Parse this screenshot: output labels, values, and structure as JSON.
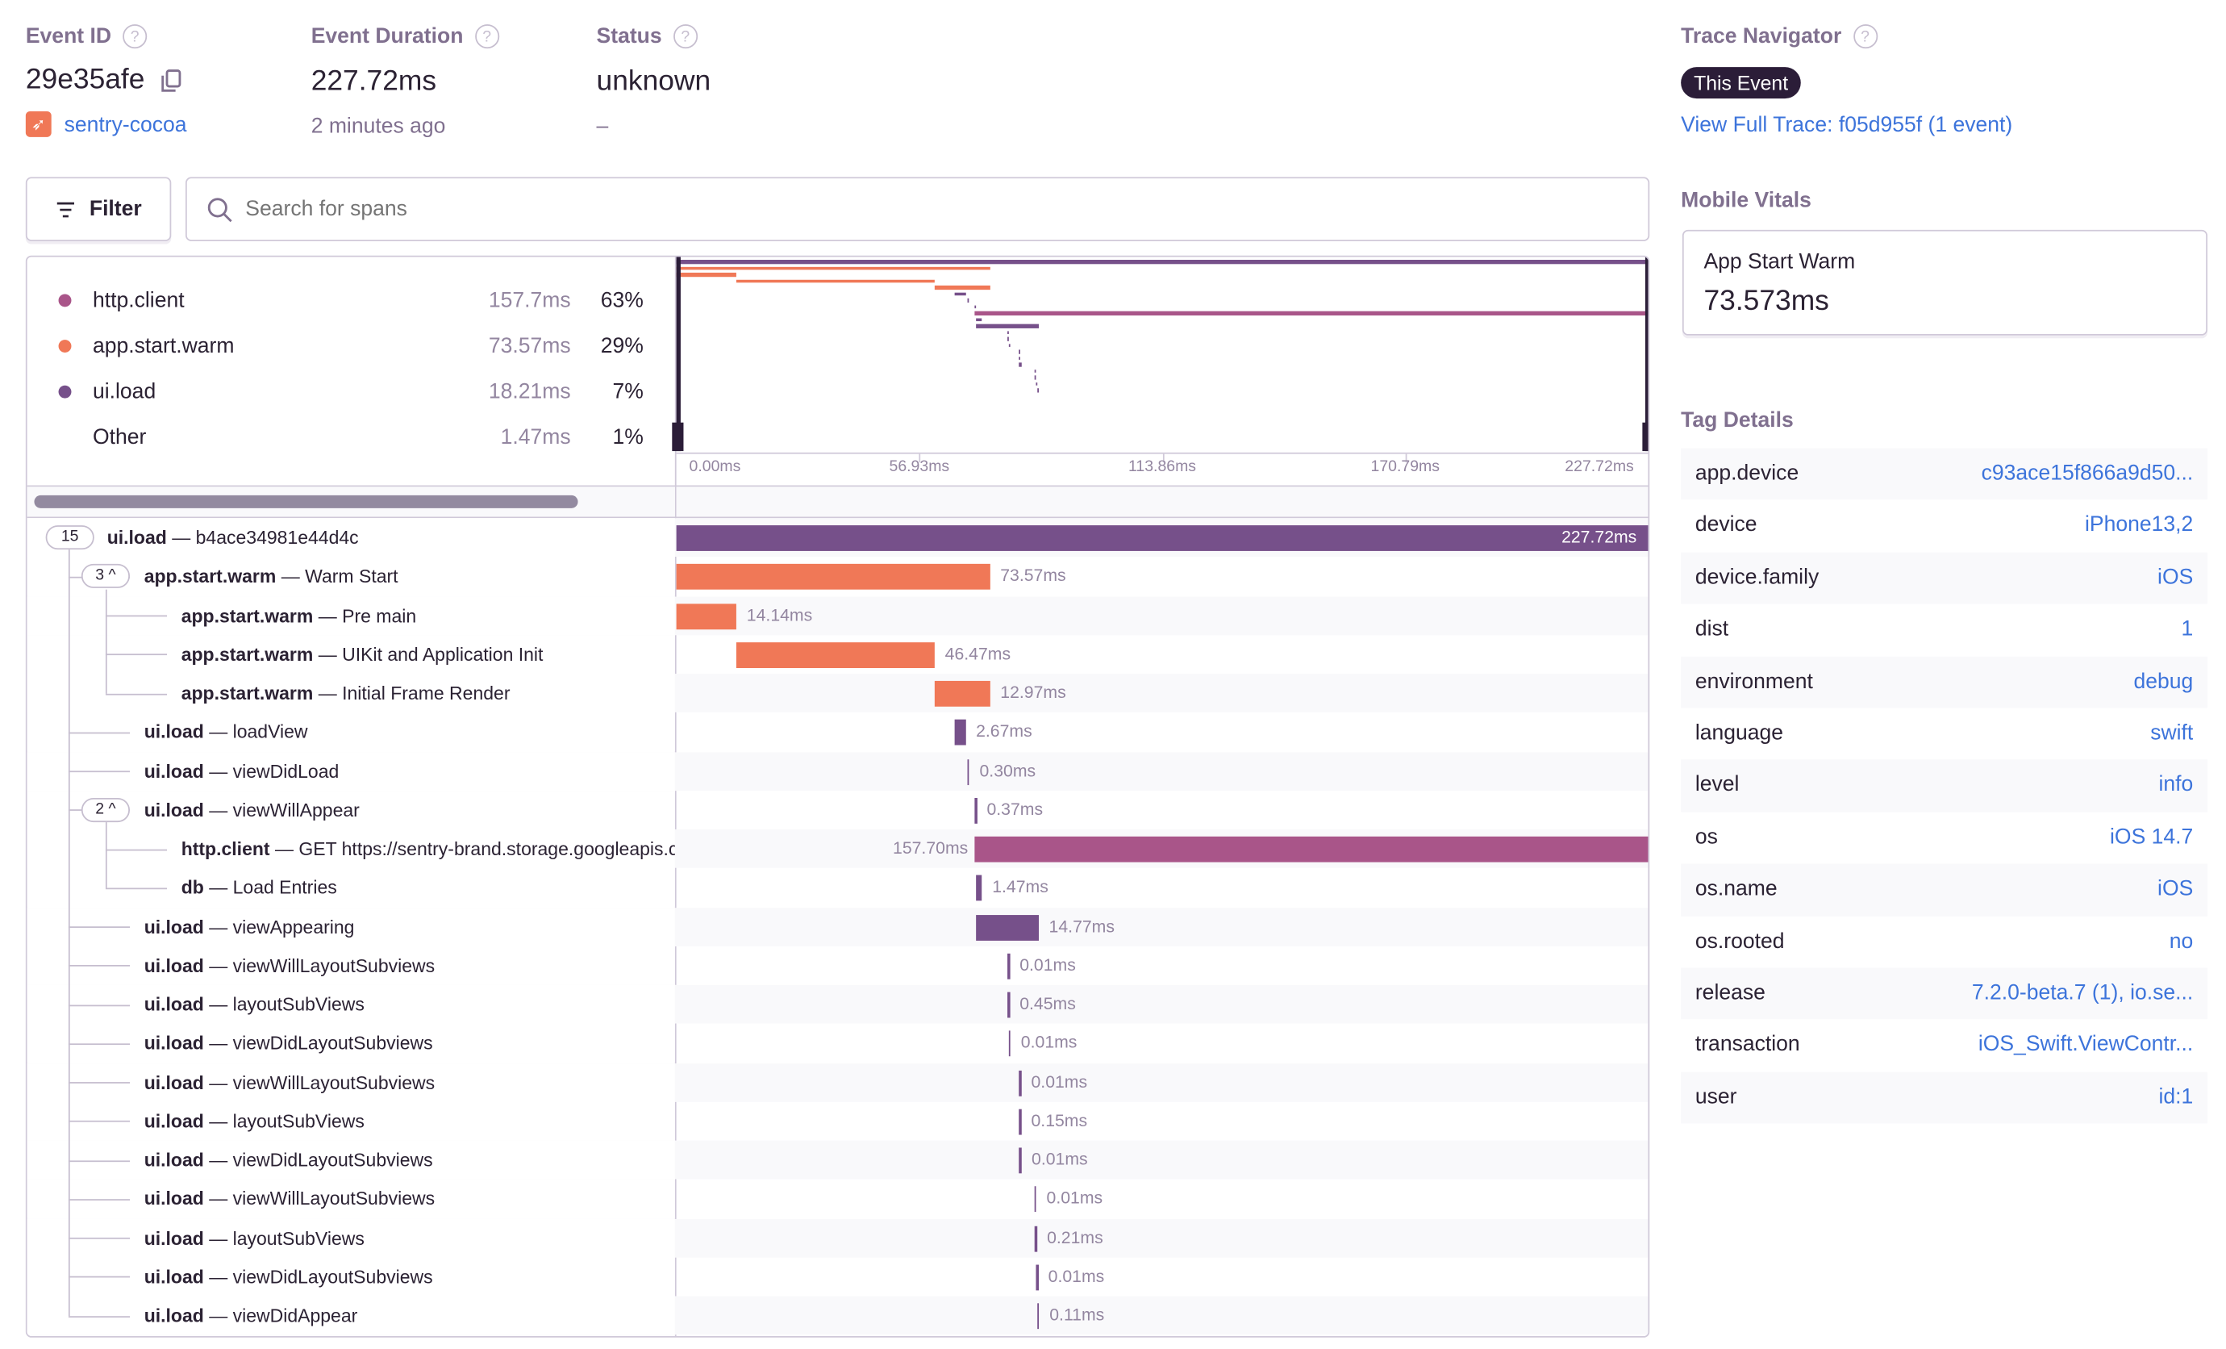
{
  "header": {
    "event_id": {
      "label": "Event ID",
      "value": "29e35afe",
      "project": "sentry-cocoa"
    },
    "duration": {
      "label": "Event Duration",
      "value": "227.72ms",
      "relative_time": "2 minutes ago"
    },
    "status": {
      "label": "Status",
      "value": "unknown",
      "sub": "–"
    }
  },
  "toolbar": {
    "filter_label": "Filter",
    "search_placeholder": "Search for spans"
  },
  "legend": [
    {
      "op": "http.client",
      "duration": "157.7ms",
      "percent": "63%",
      "color": "#a95589"
    },
    {
      "op": "app.start.warm",
      "duration": "73.57ms",
      "percent": "29%",
      "color": "#f07857"
    },
    {
      "op": "ui.load",
      "duration": "18.21ms",
      "percent": "7%",
      "color": "#76508a"
    },
    {
      "op": "Other",
      "duration": "1.47ms",
      "percent": "1%",
      "color": ""
    }
  ],
  "axis_ticks": [
    "0.00ms",
    "56.93ms",
    "113.86ms",
    "170.79ms",
    "227.72ms"
  ],
  "trace_total_ms": 227.72,
  "colors": {
    "ui.load": "#76508a",
    "app.start.warm": "#f07857",
    "http.client": "#a95589",
    "db": "#76508a"
  },
  "spans": [
    {
      "op": "ui.load",
      "desc": "b4ace34981e44d4c",
      "duration": "227.72ms",
      "start": 0,
      "ms": 227.72,
      "depth": 0,
      "badge": "15"
    },
    {
      "op": "app.start.warm",
      "desc": "Warm Start",
      "duration": "73.57ms",
      "start": 0,
      "ms": 73.57,
      "depth": 1,
      "badge": "3 ^"
    },
    {
      "op": "app.start.warm",
      "desc": "Pre main",
      "duration": "14.14ms",
      "start": 0,
      "ms": 14.14,
      "depth": 2
    },
    {
      "op": "app.start.warm",
      "desc": "UIKit and Application Init",
      "duration": "46.47ms",
      "start": 14.14,
      "ms": 46.47,
      "depth": 2
    },
    {
      "op": "app.start.warm",
      "desc": "Initial Frame Render",
      "duration": "12.97ms",
      "start": 60.61,
      "ms": 12.97,
      "depth": 2
    },
    {
      "op": "ui.load",
      "desc": "loadView",
      "duration": "2.67ms",
      "start": 65.2,
      "ms": 2.67,
      "depth": 1
    },
    {
      "op": "ui.load",
      "desc": "viewDidLoad",
      "duration": "0.30ms",
      "start": 68.2,
      "ms": 0.3,
      "depth": 1
    },
    {
      "op": "ui.load",
      "desc": "viewWillAppear",
      "duration": "0.37ms",
      "start": 69.9,
      "ms": 0.37,
      "depth": 1,
      "badge": "2 ^"
    },
    {
      "op": "http.client",
      "desc": "GET https://sentry-brand.storage.googleapis.com",
      "duration": "157.70ms",
      "start": 70.02,
      "ms": 157.7,
      "depth": 2
    },
    {
      "op": "db",
      "desc": "Load Entries",
      "duration": "1.47ms",
      "start": 70.2,
      "ms": 1.47,
      "depth": 2
    },
    {
      "op": "ui.load",
      "desc": "viewAppearing",
      "duration": "14.77ms",
      "start": 70.2,
      "ms": 14.77,
      "depth": 1
    },
    {
      "op": "ui.load",
      "desc": "viewWillLayoutSubviews",
      "duration": "0.01ms",
      "start": 77.6,
      "ms": 0.01,
      "depth": 1
    },
    {
      "op": "ui.load",
      "desc": "layoutSubViews",
      "duration": "0.45ms",
      "start": 77.6,
      "ms": 0.45,
      "depth": 1
    },
    {
      "op": "ui.load",
      "desc": "viewDidLayoutSubviews",
      "duration": "0.01ms",
      "start": 77.9,
      "ms": 0.01,
      "depth": 1
    },
    {
      "op": "ui.load",
      "desc": "viewWillLayoutSubviews",
      "duration": "0.01ms",
      "start": 80.3,
      "ms": 0.01,
      "depth": 1
    },
    {
      "op": "ui.load",
      "desc": "layoutSubViews",
      "duration": "0.15ms",
      "start": 80.3,
      "ms": 0.15,
      "depth": 1
    },
    {
      "op": "ui.load",
      "desc": "viewDidLayoutSubviews",
      "duration": "0.01ms",
      "start": 80.4,
      "ms": 0.01,
      "depth": 1
    },
    {
      "op": "ui.load",
      "desc": "viewWillLayoutSubviews",
      "duration": "0.01ms",
      "start": 83.9,
      "ms": 0.01,
      "depth": 1
    },
    {
      "op": "ui.load",
      "desc": "layoutSubViews",
      "duration": "0.21ms",
      "start": 84.0,
      "ms": 0.21,
      "depth": 1
    },
    {
      "op": "ui.load",
      "desc": "viewDidLayoutSubviews",
      "duration": "0.01ms",
      "start": 84.3,
      "ms": 0.01,
      "depth": 1
    },
    {
      "op": "ui.load",
      "desc": "viewDidAppear",
      "duration": "0.11ms",
      "start": 84.6,
      "ms": 0.11,
      "depth": 1
    }
  ],
  "trace_navigator": {
    "label": "Trace Navigator",
    "this_event": "This Event",
    "full_trace_link": "View Full Trace: f05d955f (1 event)"
  },
  "mobile_vitals": {
    "label": "Mobile Vitals",
    "name": "App Start Warm",
    "value": "73.573ms"
  },
  "tag_details": {
    "label": "Tag Details",
    "tags": [
      {
        "key": "app.device",
        "value": "c93ace15f866a9d50..."
      },
      {
        "key": "device",
        "value": "iPhone13,2"
      },
      {
        "key": "device.family",
        "value": "iOS"
      },
      {
        "key": "dist",
        "value": "1"
      },
      {
        "key": "environment",
        "value": "debug"
      },
      {
        "key": "language",
        "value": "swift"
      },
      {
        "key": "level",
        "value": "info"
      },
      {
        "key": "os",
        "value": "iOS 14.7"
      },
      {
        "key": "os.name",
        "value": "iOS"
      },
      {
        "key": "os.rooted",
        "value": "no"
      },
      {
        "key": "release",
        "value": "7.2.0-beta.7 (1), io.se..."
      },
      {
        "key": "transaction",
        "value": "iOS_Swift.ViewContr..."
      },
      {
        "key": "user",
        "value": "id:1"
      }
    ]
  }
}
